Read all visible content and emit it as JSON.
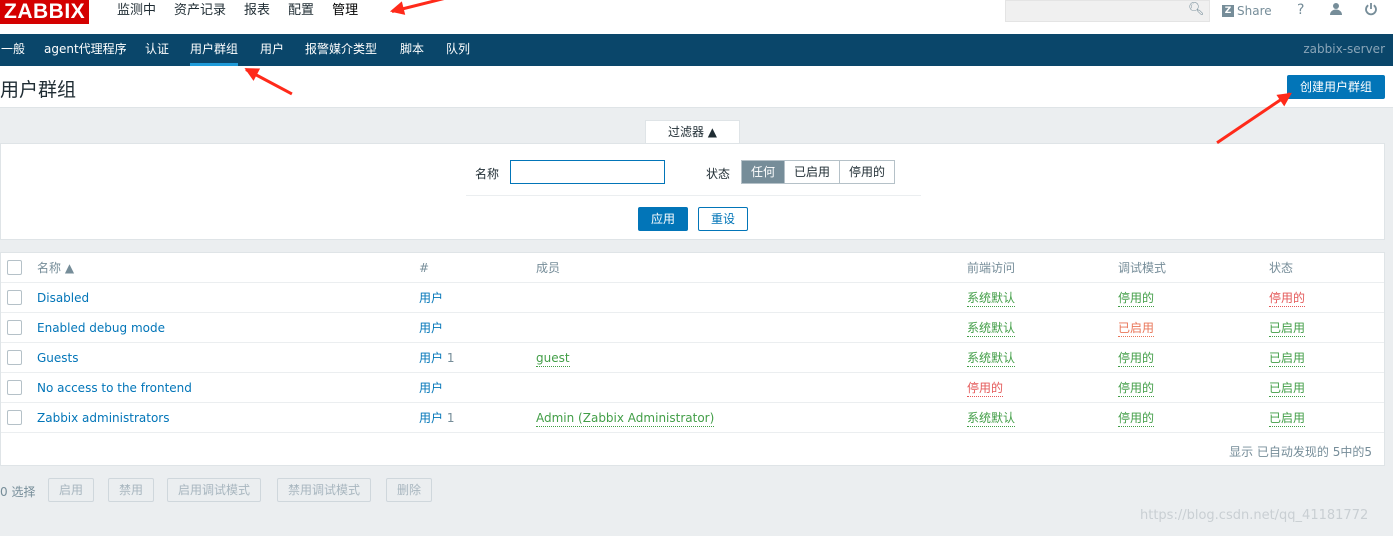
{
  "app": {
    "logo": "ZABBIX"
  },
  "main_menu": [
    {
      "label": "监测中"
    },
    {
      "label": "资产记录"
    },
    {
      "label": "报表"
    },
    {
      "label": "配置"
    },
    {
      "label": "管理",
      "active": true
    }
  ],
  "topbar": {
    "share_label": "Share",
    "help": "?",
    "user_icon": "user-icon",
    "power_icon": "power-icon",
    "search_icon": "search-icon"
  },
  "sub_menu": [
    {
      "label": "一般"
    },
    {
      "label": "agent代理程序"
    },
    {
      "label": "认证"
    },
    {
      "label": "用户群组",
      "active": true
    },
    {
      "label": "用户"
    },
    {
      "label": "报警媒介类型"
    },
    {
      "label": "脚本"
    },
    {
      "label": "队列"
    }
  ],
  "server_name": "zabbix-server",
  "page": {
    "title": "用户群组",
    "create_button": "创建用户群组"
  },
  "filter": {
    "tab_label": "过滤器 ▲",
    "name_label": "名称",
    "name_value": "",
    "status_label": "状态",
    "status_options": [
      "任何",
      "已启用",
      "停用的"
    ],
    "status_selected": "任何",
    "apply": "应用",
    "reset": "重设"
  },
  "table": {
    "headers": {
      "name": "名称 ▲",
      "count": "#",
      "members": "成员",
      "frontend": "前端访问",
      "debug": "调试模式",
      "status": "状态"
    },
    "rows": [
      {
        "name": "Disabled",
        "users": "用户",
        "count": "",
        "members": "",
        "frontend": "系统默认",
        "debug": "停用的",
        "status": "停用的"
      },
      {
        "name": "Enabled debug mode",
        "users": "用户",
        "count": "",
        "members": "",
        "frontend": "系统默认",
        "debug": "已启用",
        "status": "已启用"
      },
      {
        "name": "Guests",
        "users": "用户",
        "count": "1",
        "members": "guest",
        "frontend": "系统默认",
        "debug": "停用的",
        "status": "已启用"
      },
      {
        "name": "No access to the frontend",
        "users": "用户",
        "count": "",
        "members": "",
        "frontend": "停用的",
        "debug": "停用的",
        "status": "已启用"
      },
      {
        "name": "Zabbix administrators",
        "users": "用户",
        "count": "1",
        "members": "Admin (Zabbix Administrator)",
        "frontend": "系统默认",
        "debug": "停用的",
        "status": "已启用"
      }
    ],
    "paging": "显示 已自动发现的 5中的5"
  },
  "actions": {
    "selected": "0 选择",
    "buttons": [
      "启用",
      "禁用",
      "启用调试模式",
      "禁用调试模式",
      "删除"
    ]
  },
  "watermark": "https://blog.csdn.net/qq_41181772",
  "colors": {
    "nav_bg": "#0a466a",
    "primary": "#0275b8",
    "green": "#429e47",
    "red": "#e45959",
    "orange": "#e97659",
    "annotation_arrow": "#ff2a1a"
  }
}
